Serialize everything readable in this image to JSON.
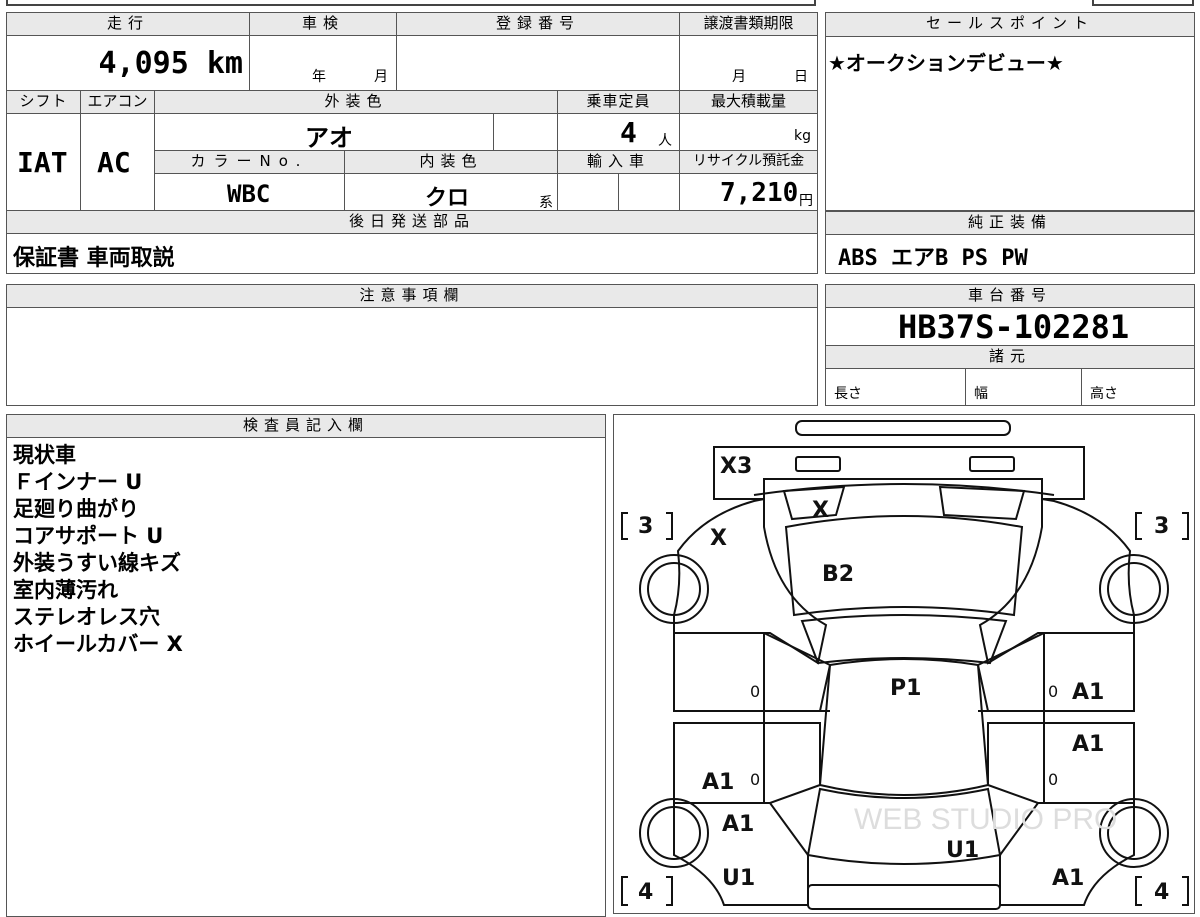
{
  "top_table": {
    "mileage_label": "走行",
    "mileage_value": "4,095 km",
    "inspection_label": "車検",
    "inspection_year": "年",
    "inspection_month": "月",
    "registration_label": "登録番号",
    "registration_value": "",
    "transfer_label": "譲渡書類期限",
    "transfer_month": "月",
    "transfer_day": "日",
    "shift_label": "シフト",
    "shift_value": "IAT",
    "ac_label": "エアコン",
    "ac_value": "AC",
    "exterior_label": "外装色",
    "exterior_value": "アオ",
    "capacity_label": "乗車定員",
    "capacity_value": "4",
    "capacity_unit": "人",
    "load_label": "最大積載量",
    "load_unit": "kg",
    "color_no_label": "カラーNo.",
    "color_no_value": "WBC",
    "interior_label": "内装色",
    "interior_value": "クロ",
    "interior_unit": "系",
    "import_label": "輸入車",
    "recycle_label": "リサイクル預託金",
    "recycle_value": "7,210",
    "recycle_unit": "円",
    "later_label": "後日発送部品",
    "later_value": "保証書 車両取説"
  },
  "sales_point": {
    "label": "セールスポイント",
    "value": "★オークションデビュー★"
  },
  "equipment": {
    "label": "純正装備",
    "value": "ABS エアB PS PW"
  },
  "caution": {
    "label": "注意事項欄"
  },
  "chassis": {
    "label": "車台番号",
    "value": "HB37S-102281",
    "spec_label": "諸元",
    "length_label": "長さ",
    "width_label": "幅",
    "height_label": "高さ"
  },
  "inspector": {
    "label": "検査員記入欄",
    "notes": [
      "現状車",
      "Ｆインナー U",
      "足廻り曲がり",
      "コアサポート U",
      "外装うすい線キズ",
      "室内薄汚れ",
      "ステレオレス穴",
      "ホイールカバー X"
    ]
  },
  "diagram": {
    "marks": {
      "front_bumper": "X3",
      "grille": "X",
      "front_left": "X",
      "hood": "B2",
      "roof": "P1",
      "left_front_door_number": "0",
      "left_rear_door_number": "0",
      "right_front_door_number": "0",
      "right_rear_door_number": "0",
      "right_front_door": "A1",
      "right_rear_door": "A1",
      "left_rear_door": "A1",
      "left_quarter": "A1",
      "left_rear": "U1",
      "rear": "U1",
      "right_rear": "A1",
      "tire_fl": "3",
      "tire_fr": "3",
      "tire_rl": "4",
      "tire_rr": "4"
    },
    "watermark": "WEB STUDIO PRO"
  }
}
